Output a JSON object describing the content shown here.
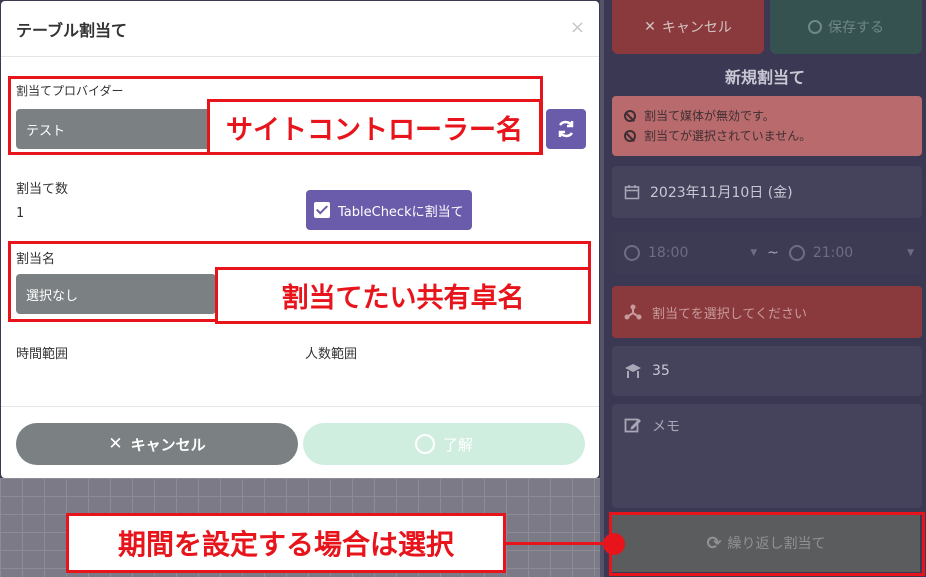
{
  "modal": {
    "title": "テーブル割当て",
    "close": "×",
    "provider_label": "割当てプロバイダー",
    "provider_value": "テスト",
    "count_label": "割当て数",
    "count_value": "1",
    "tablecheck_button": "TableCheckに割当て",
    "assign_name_label": "割当名",
    "assign_name_value": "選択なし",
    "time_range_label": "時間範囲",
    "people_range_label": "人数範囲",
    "cancel_button": "キャンセル",
    "ok_button": "了解"
  },
  "annotations": {
    "site_controller": "サイトコントローラー名",
    "shared_table": "割当てたい共有卓名",
    "period": "期間を設定する場合は選択"
  },
  "panel": {
    "cancel_button": "キャンセル",
    "save_button": "保存する",
    "title": "新規割当て",
    "alerts": [
      "割当て媒体が無効です。",
      "割当てが選択されていません。"
    ],
    "date": "2023年11月10日 (金)",
    "start_time": "18:00",
    "time_sep": "~",
    "end_time": "21:00",
    "assign_placeholder": "割当てを選択してください",
    "count": "35",
    "memo_placeholder": "メモ",
    "repeat_button": "繰り返し割当て"
  },
  "colors": {
    "accent": "#6b5bab",
    "annotation": "#e8141b",
    "danger": "#8a3a3c",
    "neutral": "#7b8083"
  }
}
